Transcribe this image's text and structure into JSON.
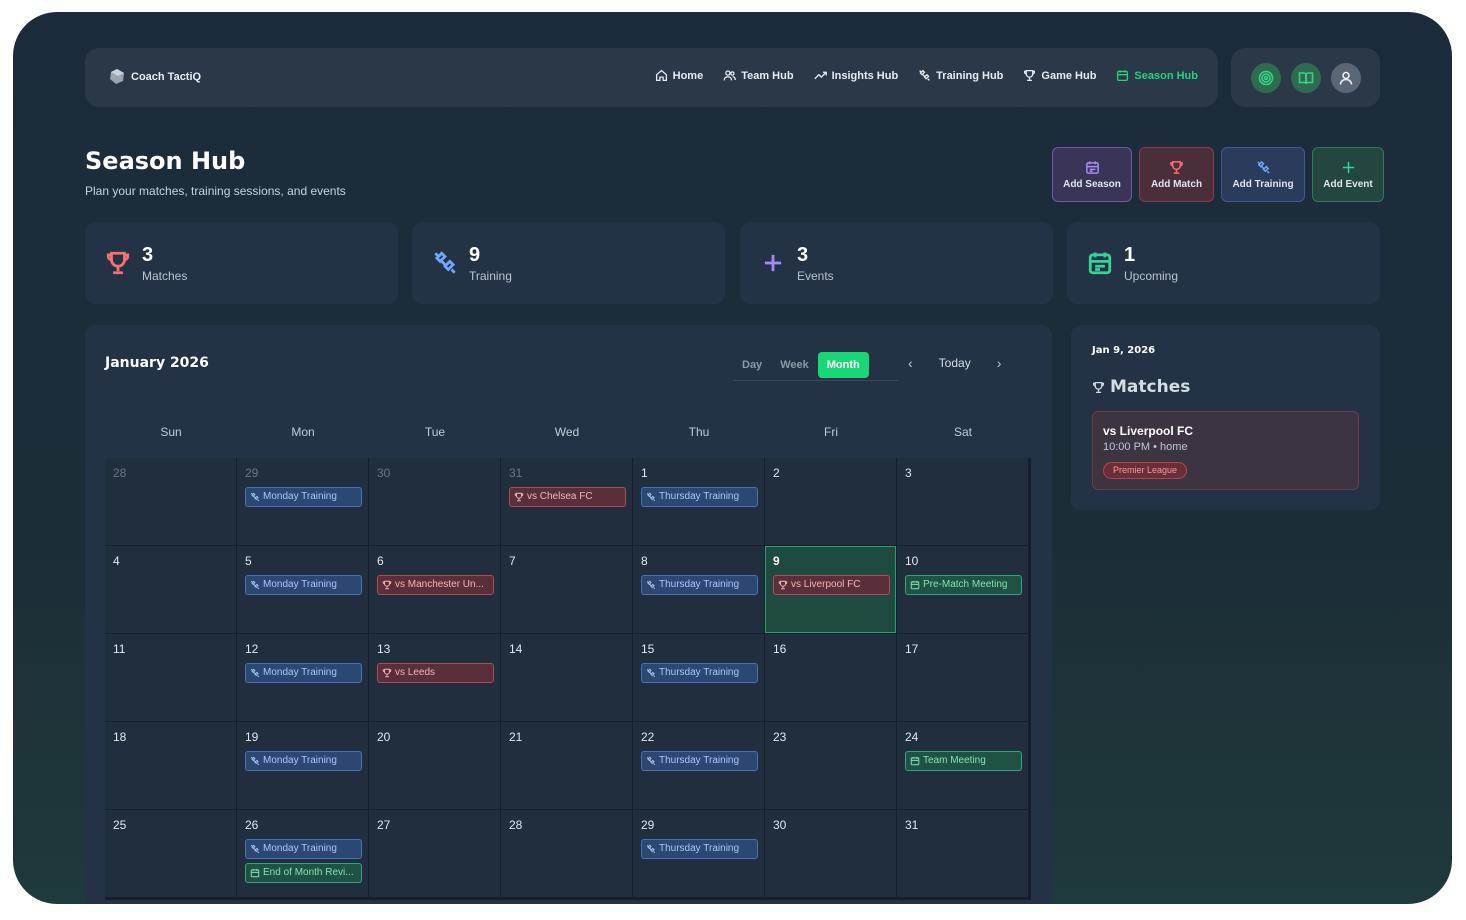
{
  "app": {
    "brand": "Coach TactiQ"
  },
  "nav": {
    "items": [
      {
        "label": "Home",
        "icon": "home-icon",
        "active": false
      },
      {
        "label": "Team Hub",
        "icon": "users-icon",
        "active": false
      },
      {
        "label": "Insights Hub",
        "icon": "trend-icon",
        "active": false
      },
      {
        "label": "Training Hub",
        "icon": "dumbbell-icon",
        "active": false
      },
      {
        "label": "Game Hub",
        "icon": "trophy-icon",
        "active": false
      },
      {
        "label": "Season Hub",
        "icon": "calendar-icon",
        "active": true
      }
    ],
    "right_icons": [
      "target-icon",
      "book-icon",
      "user-icon"
    ]
  },
  "page": {
    "title": "Season Hub",
    "subtitle": "Plan your matches, training sessions, and events"
  },
  "actions": {
    "add_season": "Add Season",
    "add_match": "Add Match",
    "add_training": "Add Training",
    "add_event": "Add Event"
  },
  "stats": [
    {
      "value": "3",
      "label": "Matches",
      "icon": "trophy-icon",
      "color": "#f87171"
    },
    {
      "value": "9",
      "label": "Training",
      "icon": "dumbbell-icon",
      "color": "#6ea8fe"
    },
    {
      "value": "3",
      "label": "Events",
      "icon": "plus-icon",
      "color": "#a78bfa"
    },
    {
      "value": "1",
      "label": "Upcoming",
      "icon": "calendar-icon",
      "color": "#34d399"
    }
  ],
  "calendar": {
    "title": "January 2026",
    "views": [
      "Day",
      "Week",
      "Month"
    ],
    "active_view": "Month",
    "today_label": "Today",
    "weekdays": [
      "Sun",
      "Mon",
      "Tue",
      "Wed",
      "Thu",
      "Fri",
      "Sat"
    ],
    "weeks": [
      [
        {
          "day": "28",
          "dim": true,
          "events": []
        },
        {
          "day": "29",
          "dim": true,
          "events": [
            {
              "type": "training",
              "title": "Monday Training"
            }
          ]
        },
        {
          "day": "30",
          "dim": true,
          "events": []
        },
        {
          "day": "31",
          "dim": true,
          "events": [
            {
              "type": "match",
              "title": "vs Chelsea FC"
            }
          ]
        },
        {
          "day": "1",
          "events": [
            {
              "type": "training",
              "title": "Thursday Training"
            }
          ]
        },
        {
          "day": "2",
          "events": []
        },
        {
          "day": "3",
          "events": []
        }
      ],
      [
        {
          "day": "4",
          "events": []
        },
        {
          "day": "5",
          "events": [
            {
              "type": "training",
              "title": "Monday Training"
            }
          ]
        },
        {
          "day": "6",
          "events": [
            {
              "type": "match",
              "title": "vs Manchester Un..."
            }
          ]
        },
        {
          "day": "7",
          "events": []
        },
        {
          "day": "8",
          "events": [
            {
              "type": "training",
              "title": "Thursday Training"
            }
          ]
        },
        {
          "day": "9",
          "today": true,
          "events": [
            {
              "type": "match",
              "title": "vs Liverpool FC"
            }
          ]
        },
        {
          "day": "10",
          "events": [
            {
              "type": "event",
              "title": "Pre-Match Meeting"
            }
          ]
        }
      ],
      [
        {
          "day": "11",
          "events": []
        },
        {
          "day": "12",
          "events": [
            {
              "type": "training",
              "title": "Monday Training"
            }
          ]
        },
        {
          "day": "13",
          "events": [
            {
              "type": "match",
              "title": "vs Leeds"
            }
          ]
        },
        {
          "day": "14",
          "events": []
        },
        {
          "day": "15",
          "events": [
            {
              "type": "training",
              "title": "Thursday Training"
            }
          ]
        },
        {
          "day": "16",
          "events": []
        },
        {
          "day": "17",
          "events": []
        }
      ],
      [
        {
          "day": "18",
          "events": []
        },
        {
          "day": "19",
          "events": [
            {
              "type": "training",
              "title": "Monday Training"
            }
          ]
        },
        {
          "day": "20",
          "events": []
        },
        {
          "day": "21",
          "events": []
        },
        {
          "day": "22",
          "events": [
            {
              "type": "training",
              "title": "Thursday Training"
            }
          ]
        },
        {
          "day": "23",
          "events": []
        },
        {
          "day": "24",
          "events": [
            {
              "type": "event",
              "title": "Team Meeting"
            }
          ]
        }
      ],
      [
        {
          "day": "25",
          "events": []
        },
        {
          "day": "26",
          "events": [
            {
              "type": "training",
              "title": "Monday Training"
            },
            {
              "type": "event",
              "title": "End of Month Revi..."
            }
          ]
        },
        {
          "day": "27",
          "events": []
        },
        {
          "day": "28",
          "events": []
        },
        {
          "day": "29",
          "events": [
            {
              "type": "training",
              "title": "Thursday Training"
            }
          ]
        },
        {
          "day": "30",
          "events": []
        },
        {
          "day": "31",
          "events": []
        }
      ]
    ]
  },
  "sidebar": {
    "date": "Jan 9, 2026",
    "section_title": "Matches",
    "match": {
      "opponent": "vs Liverpool FC",
      "meta": "10:00 PM • home",
      "competition": "Premier League"
    }
  },
  "colors": {
    "accent": "#22d37a",
    "match": "#f87171",
    "training": "#6ea8fe",
    "event": "#34d399"
  }
}
